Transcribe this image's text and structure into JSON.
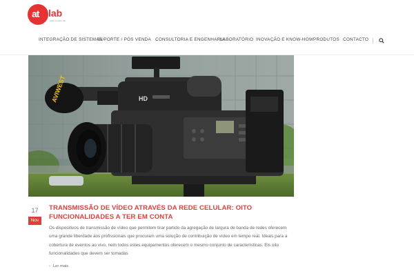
{
  "brand": {
    "logo_text_1": "at",
    "logo_text_2": "lab",
    "logo_tagline": "audio & video lab",
    "accent_color": "#d9413a"
  },
  "nav": {
    "items": [
      {
        "label": "INTEGRAÇÃO DE SISTEMAS"
      },
      {
        "label": "SUPORTE / PÓS VENDA",
        "has_dropdown": true
      },
      {
        "label": "CONSULTORIA E ENGENHARIA"
      },
      {
        "label": "LABORATÓRIO"
      },
      {
        "label": "INOVAÇÃO E KNOW-HOW"
      },
      {
        "label": "PRODUTOS"
      },
      {
        "label": "CONTACTO"
      }
    ],
    "dropdown_icon": "chevron-down-icon",
    "search_icon": "search-icon"
  },
  "hero": {
    "image": "professional-video-camera-photo",
    "mic_label": "AVIWEST",
    "camera_label": "HD"
  },
  "post": {
    "date_day": "17",
    "date_month": "Nov",
    "title": "TRANSMISSÃO DE VÍDEO ATRAVÉS DA REDE CELULAR: OITO FUNCIONALIDADES A TER EM CONTA",
    "excerpt": "Os dispositivos de transmissão de vídeo que permitem tirar partido da agregação de largura de banda de redes oferecem uma grande liberdade aos profissionais que procuram uma solução de contribuição de vídeo em tempo real. Ideais para a cobertura de eventos ao vivo, nem todos estes equipamentos oferecem o mesmo conjunto de características. Eis oito funcionalidades que devem ser tomadas",
    "read_more": "Ler mais",
    "read_more_icon": "chevron-right-icon"
  }
}
